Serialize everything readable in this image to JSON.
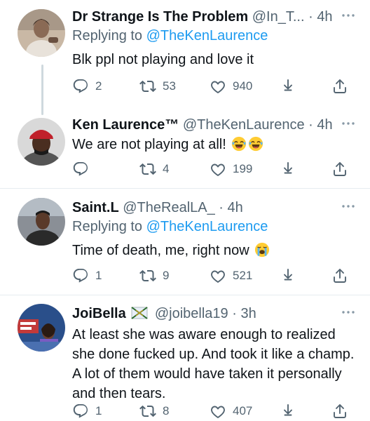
{
  "tweets": [
    {
      "name": "Dr Strange Is The Problem",
      "handle": "@In_T...",
      "sep": "·",
      "time": "4h",
      "replying_prefix": "Replying to ",
      "replying_to": "@TheKenLaurence",
      "text": "Blk ppl not playing and love it",
      "replies": "2",
      "retweets": "53",
      "likes": "940"
    },
    {
      "name": "Ken Laurence™",
      "handle": "@TheKenLaurence",
      "sep": "·",
      "time": "4h",
      "text": "We are not playing at all!",
      "replies": "",
      "retweets": "4",
      "likes": "199"
    },
    {
      "name": "Saint.L",
      "handle": "@TheRealLA_",
      "sep": "·",
      "time": "4h",
      "replying_prefix": "Replying to ",
      "replying_to": "@TheKenLaurence",
      "text": "Time of death, me, right now",
      "replies": "1",
      "retweets": "9",
      "likes": "521"
    },
    {
      "name": "JoiBella",
      "handle": "@joibella19",
      "sep": "·",
      "time": "3h",
      "text": "At least she was aware enough to realized she done fucked up. And took it like a champ. A lot of them would have taken it personally and then tears.",
      "replies": "1",
      "retweets": "8",
      "likes": "407"
    }
  ],
  "colors": {
    "text": "#0f1419",
    "secondary": "#536471",
    "link": "#1d9bf0",
    "divider": "#e6ecf0",
    "thread_line": "#cfd9de"
  },
  "icons": [
    "reply-icon",
    "retweet-icon",
    "like-icon",
    "share-icon",
    "upload-icon",
    "more-icon",
    "laughing-emoji",
    "crying-emoji",
    "flag-emoji"
  ]
}
